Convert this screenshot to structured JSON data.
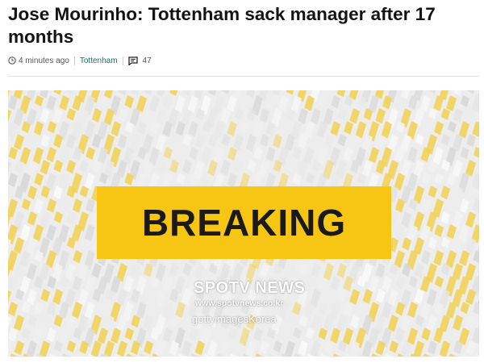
{
  "article": {
    "headline": "Jose Mourinho: Tottenham sack manager after 17 months",
    "timestamp": "4 minutes ago",
    "topic": "Tottenham",
    "comment_count": "47"
  },
  "hero": {
    "banner_text": "BREAKING",
    "watermark_brand": "SPOTV NEWS",
    "watermark_url": "www.spotvnews.co.kr",
    "watermark_getty": "gettyimagesKorea"
  },
  "colors": {
    "breaking_yellow": "#f7c514",
    "topic_link": "#1b6f5f",
    "text": "#141414"
  },
  "icons": [
    "clock-icon",
    "comment-icon"
  ]
}
